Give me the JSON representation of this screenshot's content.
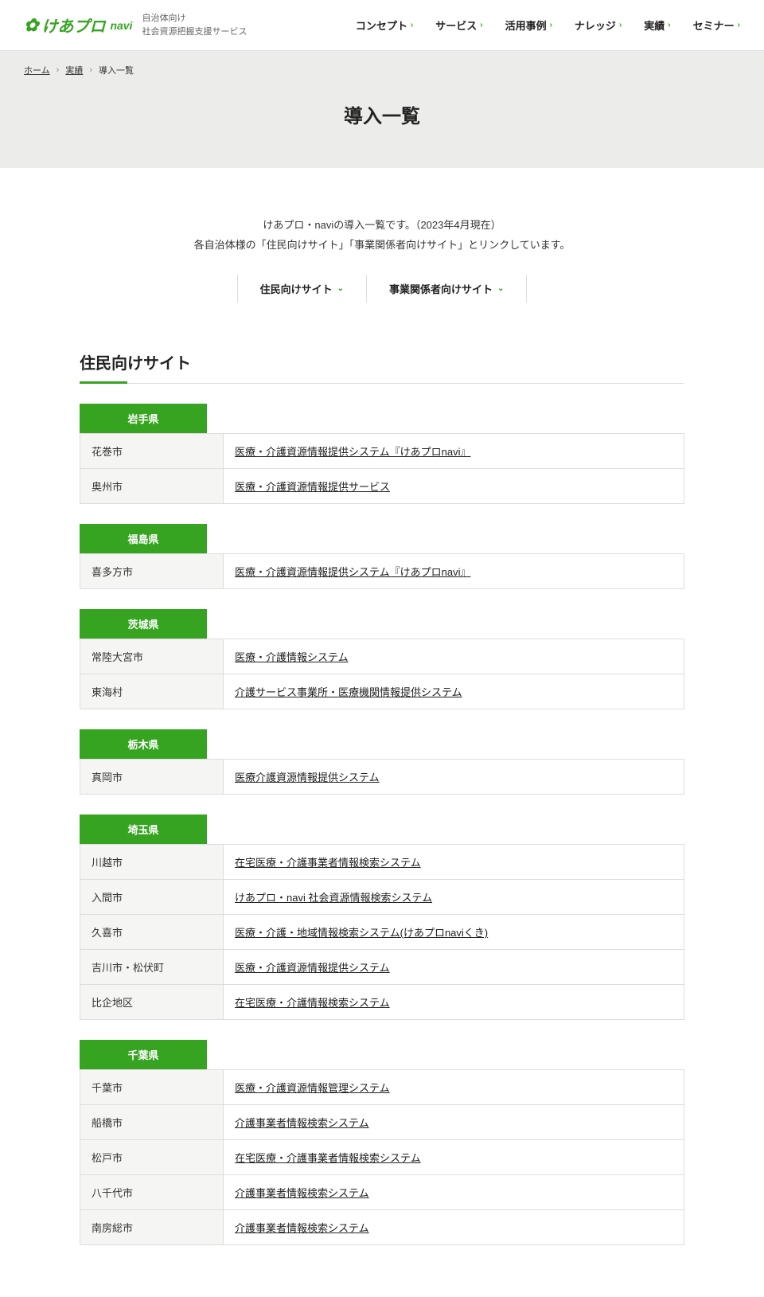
{
  "header": {
    "logo_text": "けあプロ",
    "logo_navi": "navi",
    "logo_sub_line1": "自治体向け",
    "logo_sub_line2": "社会資源把握支援サービス",
    "nav": [
      {
        "label": "コンセプト"
      },
      {
        "label": "サービス"
      },
      {
        "label": "活用事例"
      },
      {
        "label": "ナレッジ"
      },
      {
        "label": "実績"
      },
      {
        "label": "セミナー"
      }
    ]
  },
  "breadcrumb": {
    "home": "ホーム",
    "mid": "実績",
    "current": "導入一覧"
  },
  "page_title": "導入一覧",
  "intro_line1": "けあプロ・naviの導入一覧です。（2023年4月現在）",
  "intro_line2": "各自治体様の「住民向けサイト」「事業関係者向けサイト」とリンクしています。",
  "anchors": {
    "resident": "住民向けサイト",
    "business": "事業関係者向けサイト"
  },
  "section_title": "住民向けサイト",
  "prefectures": [
    {
      "name": "岩手県",
      "rows": [
        {
          "city": "花巻市",
          "link": "医療・介護資源情報提供システム『けあプロnavi』"
        },
        {
          "city": "奥州市",
          "link": "医療・介護資源情報提供サービス"
        }
      ]
    },
    {
      "name": "福島県",
      "rows": [
        {
          "city": "喜多方市",
          "link": "医療・介護資源情報提供システム『けあプロnavi』"
        }
      ]
    },
    {
      "name": "茨城県",
      "rows": [
        {
          "city": "常陸大宮市",
          "link": "医療・介護情報システム"
        },
        {
          "city": "東海村",
          "link": "介護サービス事業所・医療機関情報提供システム"
        }
      ]
    },
    {
      "name": "栃木県",
      "rows": [
        {
          "city": "真岡市",
          "link": "医療介護資源情報提供システム"
        }
      ]
    },
    {
      "name": "埼玉県",
      "rows": [
        {
          "city": "川越市",
          "link": "在宅医療・介護事業者情報検索システム"
        },
        {
          "city": "入間市",
          "link": "けあプロ・navi 社会資源情報検索システム"
        },
        {
          "city": "久喜市",
          "link": "医療・介護・地域情報検索システム(けあプロnaviくき)"
        },
        {
          "city": "吉川市・松伏町",
          "link": "医療・介護資源情報提供システム"
        },
        {
          "city": "比企地区",
          "link": "在宅医療・介護情報検索システム"
        }
      ]
    },
    {
      "name": "千葉県",
      "rows": [
        {
          "city": "千葉市",
          "link": "医療・介護資源情報管理システム"
        },
        {
          "city": "船橋市",
          "link": "介護事業者情報検索システム"
        },
        {
          "city": "松戸市",
          "link": "在宅医療・介護事業者情報検索システム"
        },
        {
          "city": "八千代市",
          "link": "介護事業者情報検索システム"
        },
        {
          "city": "南房総市",
          "link": "介護事業者情報検索システム"
        }
      ]
    }
  ]
}
